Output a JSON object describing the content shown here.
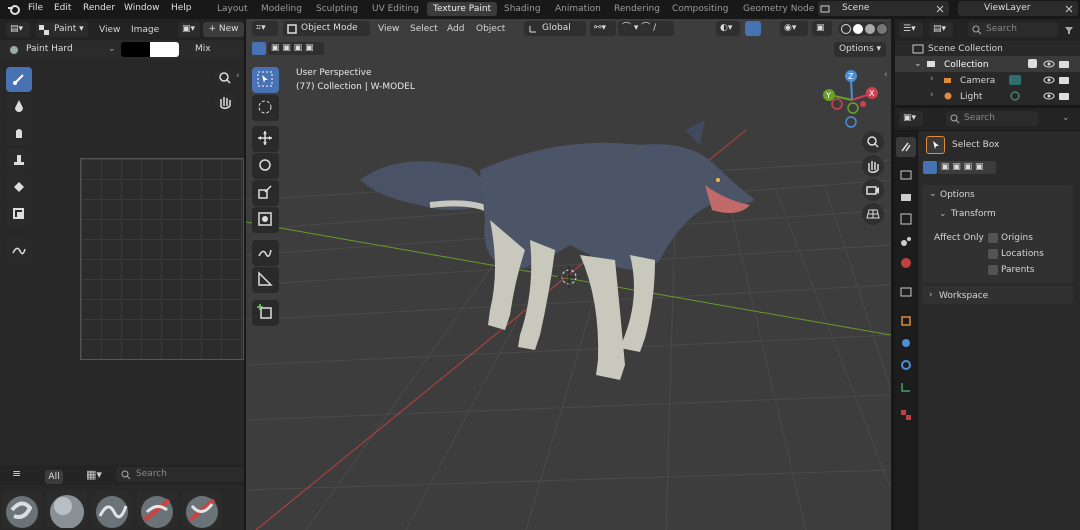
{
  "topbar": {
    "menus": [
      "File",
      "Edit",
      "Render",
      "Window",
      "Help"
    ],
    "workspaces": [
      "Layout",
      "Modeling",
      "Sculpting",
      "UV Editing",
      "Texture Paint",
      "Shading",
      "Animation",
      "Rendering",
      "Compositing",
      "Geometry Node"
    ],
    "active_workspace": "Texture Paint",
    "scene": "Scene",
    "view_layer": "ViewLayer"
  },
  "image_editor": {
    "mode": "Paint",
    "view": "View",
    "image": "Image",
    "new": "New",
    "brush_name": "Paint Hard",
    "blend": "Mix",
    "search_placeholder": "Search",
    "filter_all": "All"
  },
  "viewport": {
    "mode": "Object Mode",
    "menus": [
      "View",
      "Select",
      "Add",
      "Object"
    ],
    "orientation": "Global",
    "options": "Options",
    "overlay_title": "User Perspective",
    "overlay_sub": "(77) Collection | W-MODEL"
  },
  "outliner": {
    "search_placeholder": "Search",
    "scene_collection": "Scene Collection",
    "collection": "Collection",
    "items": [
      "Camera",
      "Light"
    ]
  },
  "properties": {
    "search_placeholder": "Search",
    "tool_name": "Select Box",
    "options": "Options",
    "transform": "Transform",
    "affect_only": "Affect Only",
    "checks": [
      "Origins",
      "Locations",
      "Parents"
    ],
    "workspace": "Workspace"
  },
  "colors": {
    "accent": "#4772b3",
    "active_ws": "#3b3b3b",
    "grid_red": "#c04040",
    "grid_green": "#6a9a2a"
  }
}
